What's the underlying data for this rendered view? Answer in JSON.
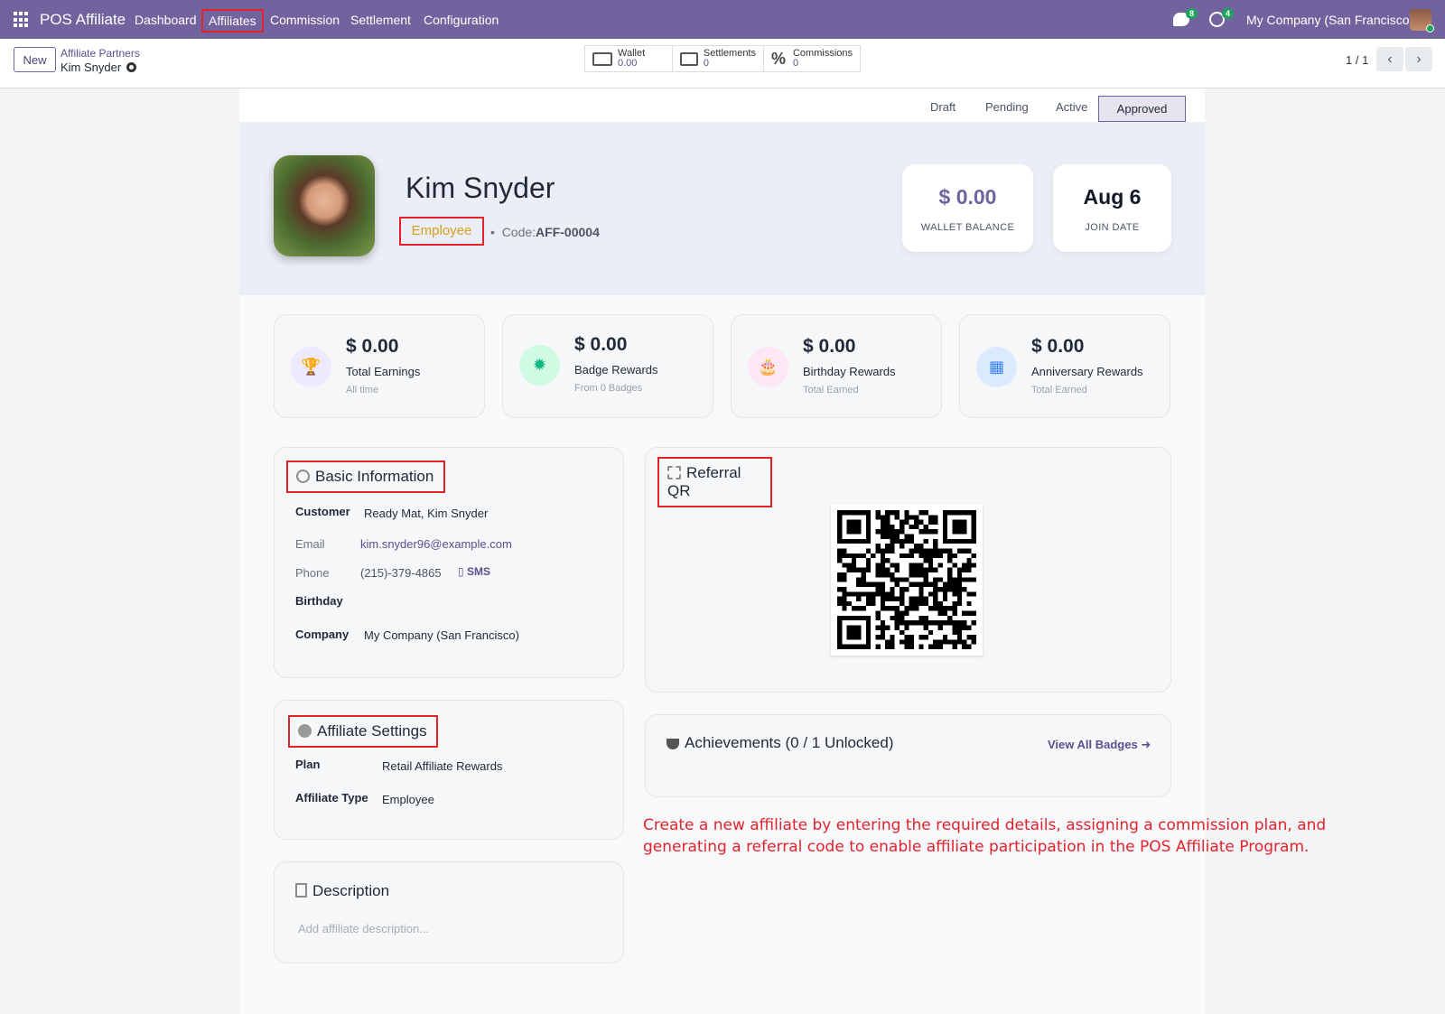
{
  "topbar": {
    "app_name": "POS Affiliate",
    "nav": [
      "Dashboard",
      "Affiliates",
      "Commission",
      "Settlement",
      "Configuration"
    ],
    "chat_badge": "8",
    "activity_badge": "4",
    "company": "My Company (San Francisco)"
  },
  "controlbar": {
    "new_label": "New",
    "breadcrumb_parent": "Affiliate Partners",
    "breadcrumb_current": "Kim Snyder",
    "smart_buttons": [
      {
        "label": "Wallet",
        "value": "0.00"
      },
      {
        "label": "Settlements",
        "value": "0"
      },
      {
        "label": "Commissions",
        "value": "0"
      }
    ],
    "pager": "1 / 1"
  },
  "status": {
    "steps": [
      "Draft",
      "Pending",
      "Active",
      "Approved"
    ],
    "current": "Approved"
  },
  "profile": {
    "name": "Kim Snyder",
    "role": "Employee",
    "code_label": "Code:",
    "code": "AFF-00004",
    "wallet_balance": "$ 0.00",
    "wallet_label": "WALLET BALANCE",
    "join_date": "Aug 6",
    "join_label": "JOIN DATE"
  },
  "kpis": [
    {
      "value": "$ 0.00",
      "label": "Total Earnings",
      "sub": "All time",
      "icon": "trophy-icon",
      "color": "#8b5cf6"
    },
    {
      "value": "$ 0.00",
      "label": "Badge Rewards",
      "sub": "From 0 Badges",
      "icon": "badge-icon",
      "color": "#10b981"
    },
    {
      "value": "$ 0.00",
      "label": "Birthday Rewards",
      "sub": "Total Earned",
      "icon": "cake-icon",
      "color": "#ec4899"
    },
    {
      "value": "$ 0.00",
      "label": "Anniversary Rewards",
      "sub": "Total Earned",
      "icon": "calendar-icon",
      "color": "#3b82f6"
    }
  ],
  "basic_info": {
    "title": "Basic Information",
    "customer_label": "Customer",
    "customer": "Ready Mat, Kim Snyder",
    "email_label": "Email",
    "email": "kim.snyder96@example.com",
    "phone_label": "Phone",
    "phone": "(215)-379-4865",
    "sms": "SMS",
    "birthday_label": "Birthday",
    "company_label": "Company",
    "company": "My Company (San Francisco)"
  },
  "referral_qr": {
    "title": "Referral QR"
  },
  "affiliate_settings": {
    "title": "Affiliate Settings",
    "plan_label": "Plan",
    "plan": "Retail Affiliate Rewards",
    "type_label": "Affiliate Type",
    "type": "Employee"
  },
  "achievements": {
    "title": "Achievements (0 / 1 Unlocked)",
    "view_all": "View All Badges ➜"
  },
  "description": {
    "title": "Description",
    "placeholder": "Add affiliate description..."
  },
  "annotation": "Create a new affiliate by entering the required details, assigning a commission plan, and generating a referral code to enable affiliate participation in the POS Affiliate Program."
}
